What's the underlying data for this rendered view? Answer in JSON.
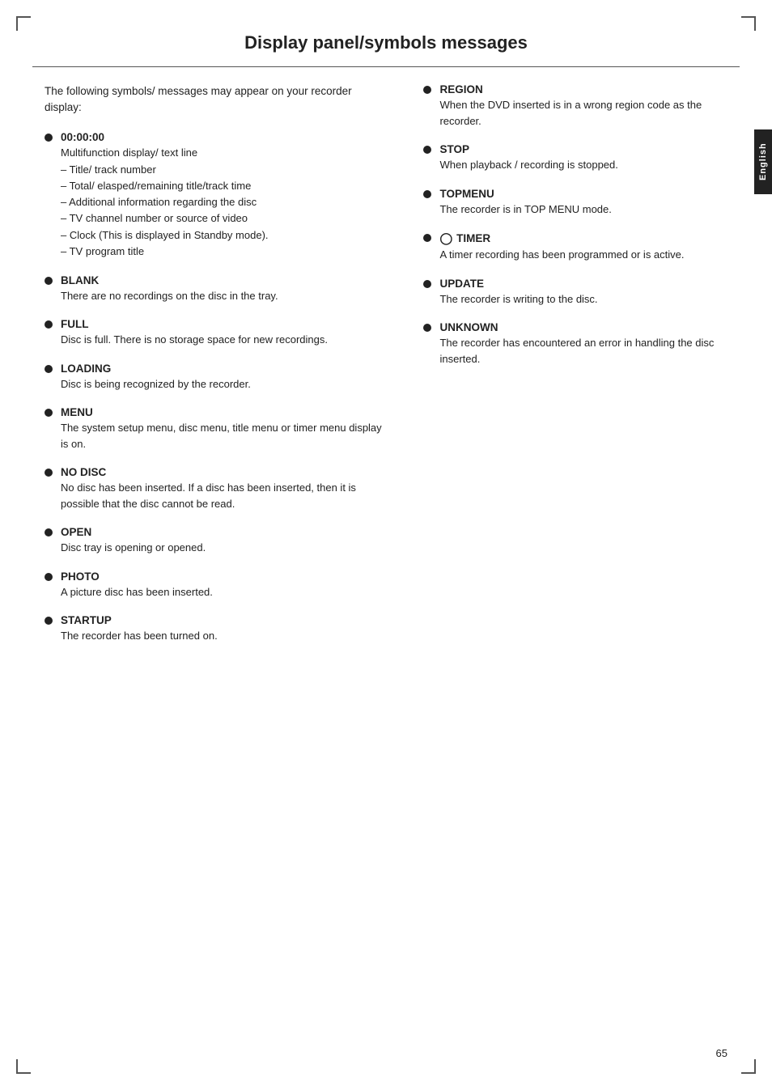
{
  "page": {
    "title": "Display panel/symbols messages",
    "page_number": "65",
    "side_tab_label": "English"
  },
  "intro": {
    "text": "The following symbols/ messages may appear on your recorder display:"
  },
  "left_items": [
    {
      "id": "time",
      "label": "00:00:00",
      "desc": "Multifunction display/ text line",
      "sub_items": [
        "Title/ track number",
        "Total/ elasped/remaining title/track time",
        "Additional information regarding the disc",
        "TV channel number or source of video",
        "Clock (This is displayed in Standby mode).",
        "TV program title"
      ]
    },
    {
      "id": "blank",
      "label": "BLANK",
      "desc": "There are no recordings on the disc in the tray.",
      "sub_items": []
    },
    {
      "id": "full",
      "label": "FULL",
      "desc": "Disc is full. There is no storage space for new recordings.",
      "sub_items": []
    },
    {
      "id": "loading",
      "label": "LOADING",
      "desc": "Disc is being recognized by the recorder.",
      "sub_items": []
    },
    {
      "id": "menu",
      "label": "MENU",
      "desc": "The system setup menu, disc menu, title menu or timer menu display is on.",
      "sub_items": []
    },
    {
      "id": "nodisc",
      "label": "NO DISC",
      "desc": "No disc has been inserted. If a disc has been inserted, then it is possible that the disc cannot be read.",
      "sub_items": []
    },
    {
      "id": "open",
      "label": "OPEN",
      "desc": "Disc tray is opening or opened.",
      "sub_items": []
    },
    {
      "id": "photo",
      "label": "PHOTO",
      "desc": "A picture disc has been inserted.",
      "sub_items": []
    },
    {
      "id": "startup",
      "label": "STARTUP",
      "desc": "The recorder has been turned on.",
      "sub_items": []
    }
  ],
  "right_items": [
    {
      "id": "region",
      "label": "REGION",
      "desc": "When the DVD inserted is in a wrong region code as the recorder.",
      "has_timer_icon": false,
      "sub_items": []
    },
    {
      "id": "stop",
      "label": "STOP",
      "desc": "When playback / recording is stopped.",
      "has_timer_icon": false,
      "sub_items": []
    },
    {
      "id": "topmenu",
      "label": "TOPMENU",
      "desc": "The recorder is in TOP MENU mode.",
      "has_timer_icon": false,
      "sub_items": []
    },
    {
      "id": "timer",
      "label": "TIMER",
      "desc": "A timer recording has been programmed or is active.",
      "has_timer_icon": true,
      "sub_items": []
    },
    {
      "id": "update",
      "label": "UPDATE",
      "desc": "The recorder is writing to the disc.",
      "has_timer_icon": false,
      "sub_items": []
    },
    {
      "id": "unknown",
      "label": "UNKNOWN",
      "desc": "The recorder has encountered an error in handling the disc inserted.",
      "has_timer_icon": false,
      "sub_items": []
    }
  ]
}
